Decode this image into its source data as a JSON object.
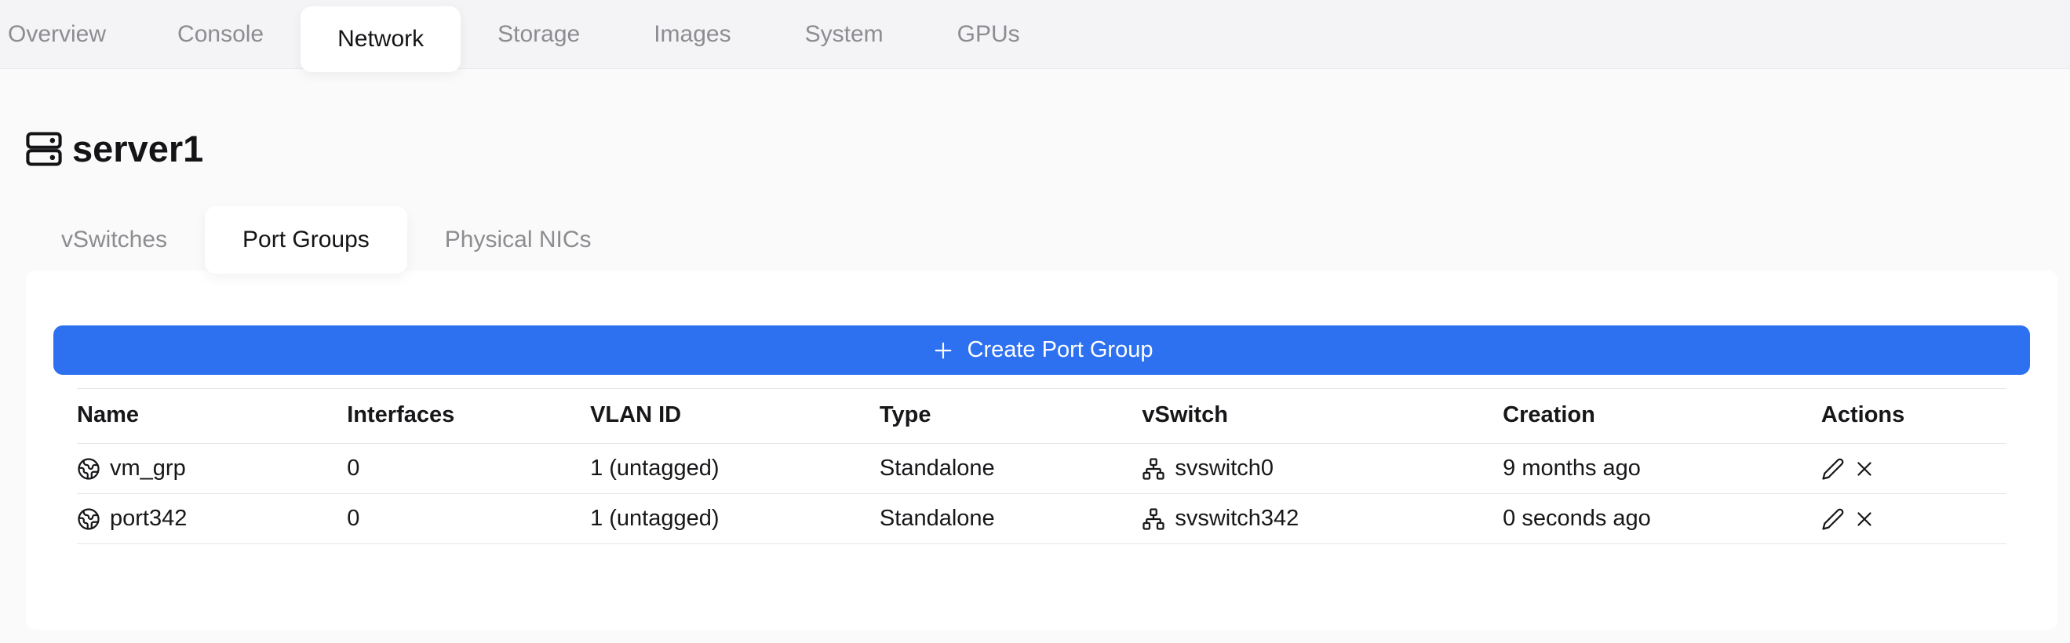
{
  "topbar": {
    "tabs": [
      {
        "label": "Overview",
        "active": false
      },
      {
        "label": "Console",
        "active": false
      },
      {
        "label": "Network",
        "active": true
      },
      {
        "label": "Storage",
        "active": false
      },
      {
        "label": "Images",
        "active": false
      },
      {
        "label": "System",
        "active": false
      },
      {
        "label": "GPUs",
        "active": false
      }
    ]
  },
  "page": {
    "title": "server1"
  },
  "subtabs": {
    "items": [
      {
        "label": "vSwitches",
        "active": false
      },
      {
        "label": "Port Groups",
        "active": true
      },
      {
        "label": "Physical NICs",
        "active": false
      }
    ]
  },
  "port_groups": {
    "create_button_label": "Create Port Group",
    "table": {
      "columns": [
        "Name",
        "Interfaces",
        "VLAN ID",
        "Type",
        "vSwitch",
        "Creation",
        "Actions"
      ],
      "rows": [
        {
          "name": "vm_grp",
          "interfaces": "0",
          "vlan_id": "1 (untagged)",
          "type": "Standalone",
          "vswitch": "svswitch0",
          "creation": "9 months ago"
        },
        {
          "name": "port342",
          "interfaces": "0",
          "vlan_id": "1 (untagged)",
          "type": "Standalone",
          "vswitch": "svswitch342",
          "creation": "0 seconds ago"
        }
      ]
    }
  },
  "colors": {
    "accent_blue": "#2e71f0",
    "page_background": "#fafafa",
    "tabbar_background": "#f4f4f7",
    "inactive_tab_text": "#8d8d91",
    "table_border": "#e6e6e9"
  }
}
